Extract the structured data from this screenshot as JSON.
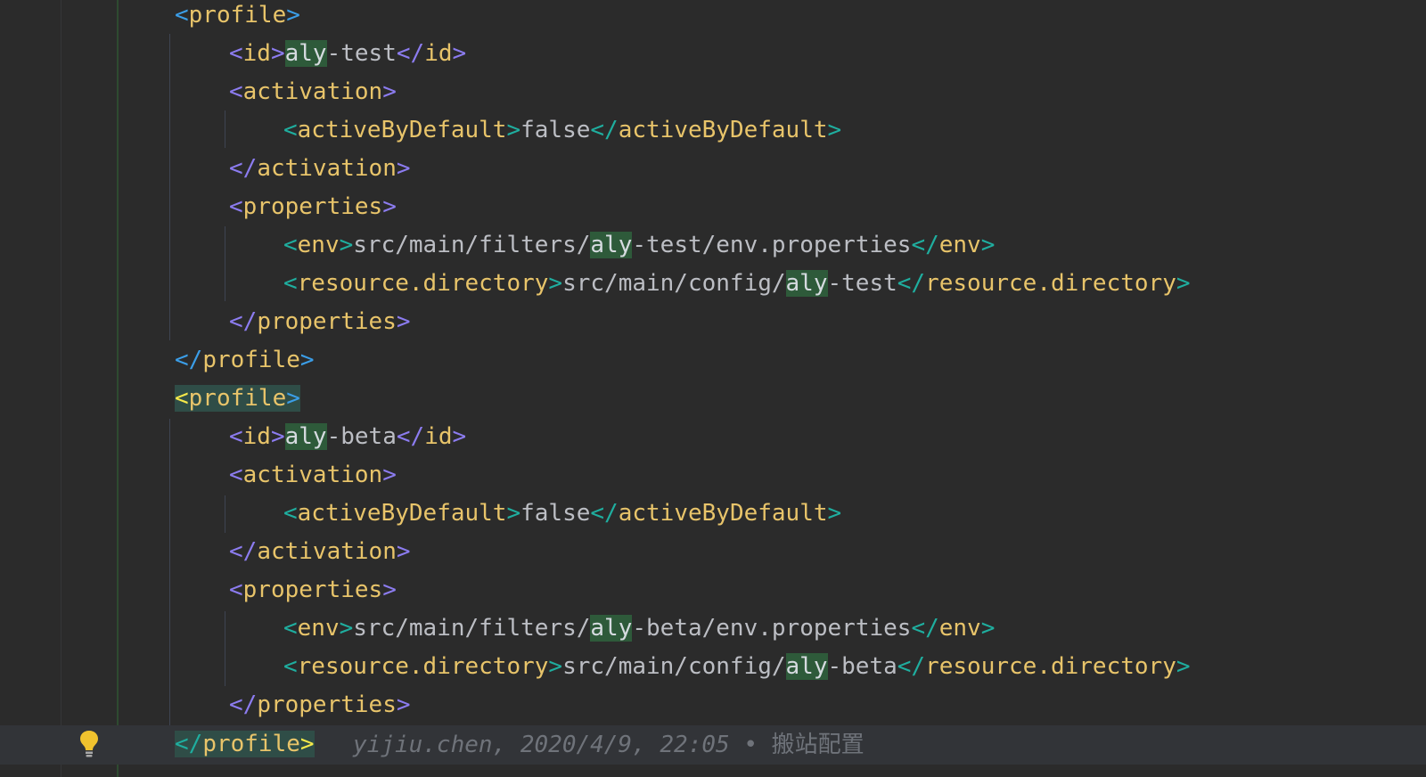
{
  "editor": {
    "lines": [
      {
        "id": "l1",
        "parts": [
          [
            "punc-b",
            "<"
          ],
          [
            "name-gold",
            "profile"
          ],
          [
            "punc-b",
            ">"
          ]
        ]
      },
      {
        "id": "l2",
        "parts": [
          [
            "punc-v",
            "<"
          ],
          [
            "name-gold",
            "id"
          ],
          [
            "punc-v",
            ">"
          ],
          [
            "hl",
            "aly"
          ],
          [
            "txt",
            "-test"
          ],
          [
            "punc-v",
            "</"
          ],
          [
            "name-gold",
            "id"
          ],
          [
            "punc-v",
            ">"
          ]
        ]
      },
      {
        "id": "l3",
        "parts": [
          [
            "punc-v",
            "<"
          ],
          [
            "name-gold",
            "activation"
          ],
          [
            "punc-v",
            ">"
          ]
        ]
      },
      {
        "id": "l4",
        "parts": [
          [
            "punc-t",
            "<"
          ],
          [
            "name-gold",
            "activeByDefault"
          ],
          [
            "punc-t",
            ">"
          ],
          [
            "txt",
            "false"
          ],
          [
            "punc-t",
            "</"
          ],
          [
            "name-gold",
            "activeByDefault"
          ],
          [
            "punc-t",
            ">"
          ]
        ]
      },
      {
        "id": "l5",
        "parts": [
          [
            "punc-v",
            "</"
          ],
          [
            "name-gold",
            "activation"
          ],
          [
            "punc-v",
            ">"
          ]
        ]
      },
      {
        "id": "l6",
        "parts": [
          [
            "punc-v",
            "<"
          ],
          [
            "name-gold",
            "properties"
          ],
          [
            "punc-v",
            ">"
          ]
        ]
      },
      {
        "id": "l7",
        "parts": [
          [
            "punc-t",
            "<"
          ],
          [
            "name-gold",
            "env"
          ],
          [
            "punc-t",
            ">"
          ],
          [
            "txt",
            "src/main/filters/"
          ],
          [
            "hl",
            "aly"
          ],
          [
            "txt",
            "-test/env.properties"
          ],
          [
            "punc-t",
            "</"
          ],
          [
            "name-gold",
            "env"
          ],
          [
            "punc-t",
            ">"
          ]
        ]
      },
      {
        "id": "l8",
        "parts": [
          [
            "punc-t",
            "<"
          ],
          [
            "name-gold",
            "resource.directory"
          ],
          [
            "punc-t",
            ">"
          ],
          [
            "txt",
            "src/main/config/"
          ],
          [
            "hl",
            "aly"
          ],
          [
            "txt",
            "-test"
          ],
          [
            "punc-t",
            "</"
          ],
          [
            "name-gold",
            "resource.directory"
          ],
          [
            "punc-t",
            ">"
          ]
        ]
      },
      {
        "id": "l9",
        "parts": [
          [
            "punc-v",
            "</"
          ],
          [
            "name-gold",
            "properties"
          ],
          [
            "punc-v",
            ">"
          ]
        ]
      },
      {
        "id": "l10",
        "parts": [
          [
            "punc-b",
            "</"
          ],
          [
            "name-gold",
            "profile"
          ],
          [
            "punc-b",
            ">"
          ]
        ]
      },
      {
        "id": "l11",
        "parts": [
          [
            "match-open",
            "<"
          ],
          [
            "match-name",
            "profile"
          ],
          [
            "match-close",
            ">"
          ]
        ]
      },
      {
        "id": "l12",
        "parts": [
          [
            "punc-v",
            "<"
          ],
          [
            "name-gold",
            "id"
          ],
          [
            "punc-v",
            ">"
          ],
          [
            "hl",
            "aly"
          ],
          [
            "txt",
            "-beta"
          ],
          [
            "punc-v",
            "</"
          ],
          [
            "name-gold",
            "id"
          ],
          [
            "punc-v",
            ">"
          ]
        ]
      },
      {
        "id": "l13",
        "parts": [
          [
            "punc-v",
            "<"
          ],
          [
            "name-gold",
            "activation"
          ],
          [
            "punc-v",
            ">"
          ]
        ]
      },
      {
        "id": "l14",
        "parts": [
          [
            "punc-t",
            "<"
          ],
          [
            "name-gold",
            "activeByDefault"
          ],
          [
            "punc-t",
            ">"
          ],
          [
            "txt",
            "false"
          ],
          [
            "punc-t",
            "</"
          ],
          [
            "name-gold",
            "activeByDefault"
          ],
          [
            "punc-t",
            ">"
          ]
        ]
      },
      {
        "id": "l15",
        "parts": [
          [
            "punc-v",
            "</"
          ],
          [
            "name-gold",
            "activation"
          ],
          [
            "punc-v",
            ">"
          ]
        ]
      },
      {
        "id": "l16",
        "parts": [
          [
            "punc-v",
            "<"
          ],
          [
            "name-gold",
            "properties"
          ],
          [
            "punc-v",
            ">"
          ]
        ]
      },
      {
        "id": "l17",
        "parts": [
          [
            "punc-t",
            "<"
          ],
          [
            "name-gold",
            "env"
          ],
          [
            "punc-t",
            ">"
          ],
          [
            "txt",
            "src/main/filters/"
          ],
          [
            "hl",
            "aly"
          ],
          [
            "txt",
            "-beta/env.properties"
          ],
          [
            "punc-t",
            "</"
          ],
          [
            "name-gold",
            "env"
          ],
          [
            "punc-t",
            ">"
          ]
        ]
      },
      {
        "id": "l18",
        "parts": [
          [
            "punc-t",
            "<"
          ],
          [
            "name-gold",
            "resource.directory"
          ],
          [
            "punc-t",
            ">"
          ],
          [
            "txt",
            "src/main/config/"
          ],
          [
            "hl",
            "aly"
          ],
          [
            "txt",
            "-beta"
          ],
          [
            "punc-t",
            "</"
          ],
          [
            "name-gold",
            "resource.directory"
          ],
          [
            "punc-t",
            ">"
          ]
        ]
      },
      {
        "id": "l19",
        "parts": [
          [
            "punc-v",
            "</"
          ],
          [
            "name-gold",
            "properties"
          ],
          [
            "punc-v",
            ">"
          ]
        ]
      },
      {
        "id": "l20",
        "parts": [
          [
            "match-open",
            "</"
          ],
          [
            "match-name",
            "profile"
          ],
          [
            "match-close",
            ">"
          ]
        ]
      }
    ],
    "blame": {
      "author": "yijiu.chen",
      "date": "2020/4/9, 22:05",
      "separator": " • ",
      "message": "搬站配置"
    },
    "icons": {
      "intention": "lightbulb-icon"
    },
    "colors": {
      "background": "#2b2b2b",
      "tag_name": "#e8c46a",
      "text": "#bcbec4",
      "search_highlight": "#2e5a3a",
      "brace_match": "#f6e94a",
      "bulb": "#f0c22e"
    }
  }
}
